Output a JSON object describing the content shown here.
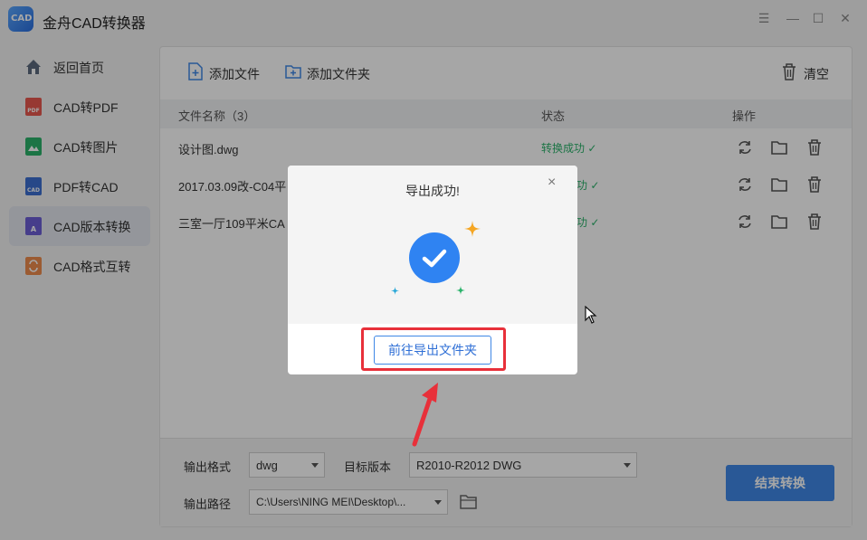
{
  "app": {
    "title": "金舟CAD转换器",
    "logo_text": "CAD"
  },
  "window_controls": {
    "menu": "☰",
    "minimize": "—",
    "maximize": "☐",
    "close": "✕"
  },
  "sidebar": {
    "items": [
      {
        "label": "返回首页",
        "icon": "home-icon",
        "color": "#5d6b7e"
      },
      {
        "label": "CAD转PDF",
        "icon": "pdf-icon",
        "color": "#e8584f",
        "tag": "PDF"
      },
      {
        "label": "CAD转图片",
        "icon": "image-icon",
        "color": "#2bb36b",
        "tag": ""
      },
      {
        "label": "PDF转CAD",
        "icon": "cad-icon",
        "color": "#3c6fd1",
        "tag": "CAD"
      },
      {
        "label": "CAD版本转换",
        "icon": "version-icon",
        "color": "#6c5fd6",
        "tag": "A"
      },
      {
        "label": "CAD格式互转",
        "icon": "format-icon",
        "color": "#ef8c4d",
        "tag": ""
      }
    ],
    "active_index": 4
  },
  "toolbar": {
    "add_file": "添加文件",
    "add_folder": "添加文件夹",
    "clear": "清空"
  },
  "table": {
    "headers": {
      "name": "文件名称（3）",
      "status": "状态",
      "actions": "操作"
    },
    "rows": [
      {
        "name": "设计图.dwg",
        "status": "转换成功"
      },
      {
        "name": "2017.03.09改-C04平",
        "status": "功"
      },
      {
        "name": "三室一厅109平米CA",
        "status": "功"
      }
    ]
  },
  "settings": {
    "format_label": "输出格式",
    "format_value": "dwg",
    "version_label": "目标版本",
    "version_value": "R2010-R2012 DWG",
    "path_label": "输出路径",
    "path_value": "C:\\Users\\NING MEI\\Desktop\\...",
    "end_button": "结束转换"
  },
  "dialog": {
    "title": "导出成功!",
    "close": "×",
    "button": "前往导出文件夹"
  },
  "colors": {
    "accent": "#3f87e6",
    "success": "#2bb36b",
    "highlight": "#e8303a"
  }
}
